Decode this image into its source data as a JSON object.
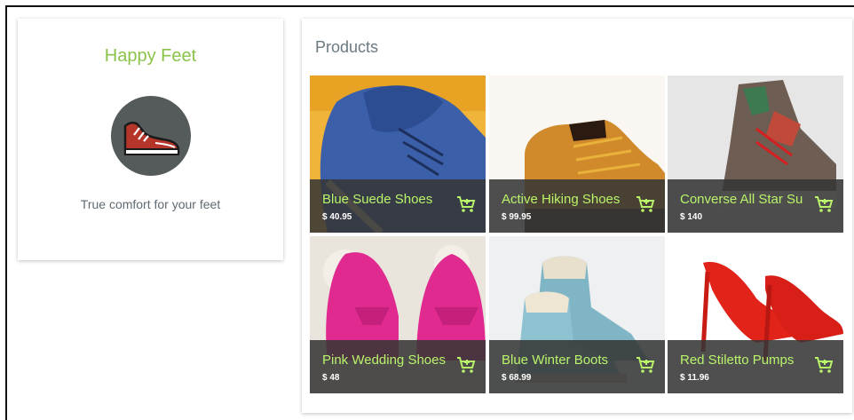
{
  "store": {
    "title": "Happy Feet",
    "tagline": "True comfort for your feet",
    "logo_icon": "sneaker-icon"
  },
  "products": {
    "title": "Products",
    "items": [
      {
        "name": "Blue Suede Shoes",
        "price": "$ 40.95",
        "photo_color": "#3b5fa8"
      },
      {
        "name": "Active Hiking Shoes",
        "price": "$ 99.95",
        "photo_color": "#c9862e"
      },
      {
        "name": "Converse All Star Su",
        "price": "$ 140",
        "photo_color": "#7a6a5a"
      },
      {
        "name": "Pink Wedding Shoes",
        "price": "$ 48",
        "photo_color": "#e02a8f"
      },
      {
        "name": "Blue Winter Boots",
        "price": "$ 68.99",
        "photo_color": "#7fb5c4"
      },
      {
        "name": "Red Stiletto Pumps",
        "price": "$ 11.96",
        "photo_color": "#e2231a"
      }
    ],
    "cart_icon": "add-to-cart-icon"
  },
  "colors": {
    "accent": "#8bc34a",
    "caption_text": "#b9f36a",
    "caption_bg": "#373737"
  }
}
